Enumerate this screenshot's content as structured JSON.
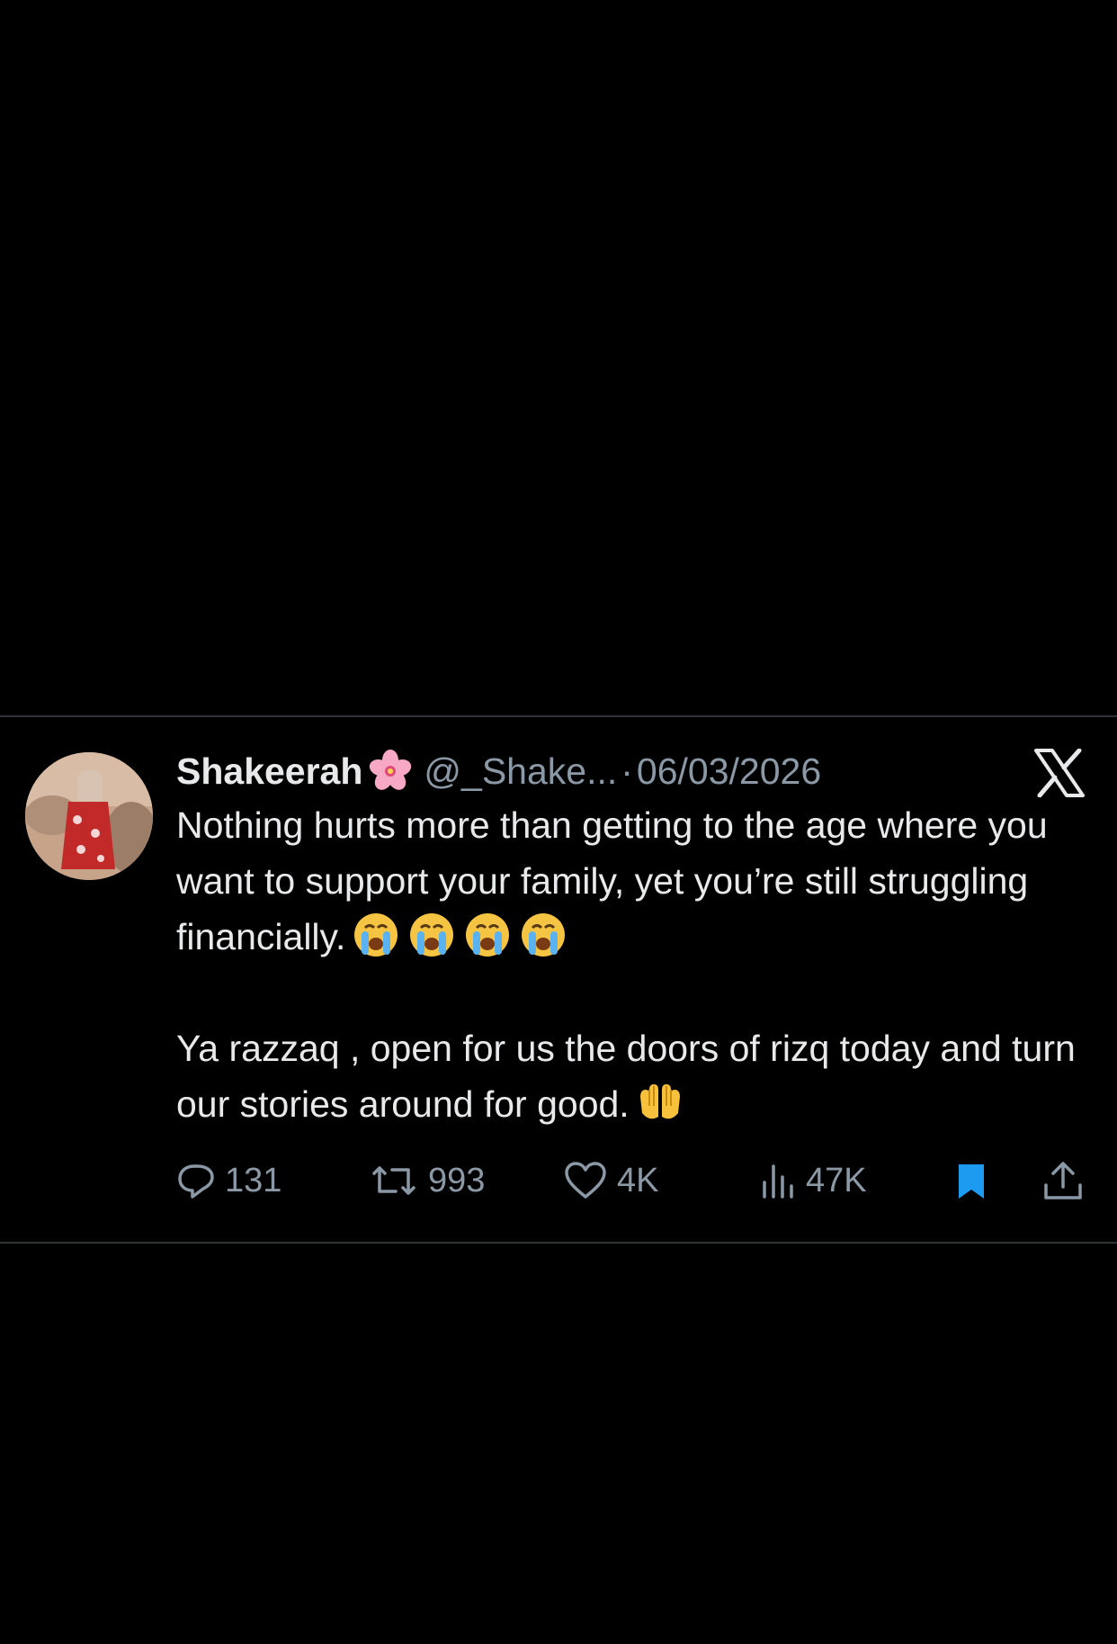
{
  "tweet": {
    "display_name": "Shakeerah",
    "name_emoji": "cherry-blossom",
    "handle": "@_Shake...",
    "separator": "·",
    "date": "06/03/2026",
    "paragraph_1": "Nothing hurts more than getting to the age where you want to support your family, yet you’re still struggling financially.",
    "paragraph_1_emojis": [
      "loudly-crying-face",
      "loudly-crying-face",
      "loudly-crying-face",
      "loudly-crying-face"
    ],
    "paragraph_2": "Ya razzaq , open for us the doors of rizq today and turn our stories around for good.",
    "paragraph_2_emojis": [
      "palms-up-together"
    ]
  },
  "actions": {
    "replies": "131",
    "reposts": "993",
    "likes": "4K",
    "views": "47K",
    "bookmarked": true
  },
  "icons": {
    "reply": "reply-icon",
    "repost": "repost-icon",
    "like": "heart-icon",
    "views": "views-icon",
    "bookmark": "bookmark-icon",
    "share": "share-icon",
    "brand": "x-logo-icon"
  },
  "colors": {
    "background": "#000000",
    "text_primary": "#e7e9ea",
    "text_secondary": "#8b98a5",
    "divider": "#2f3336",
    "bookmark_accent": "#1d9bf0"
  }
}
